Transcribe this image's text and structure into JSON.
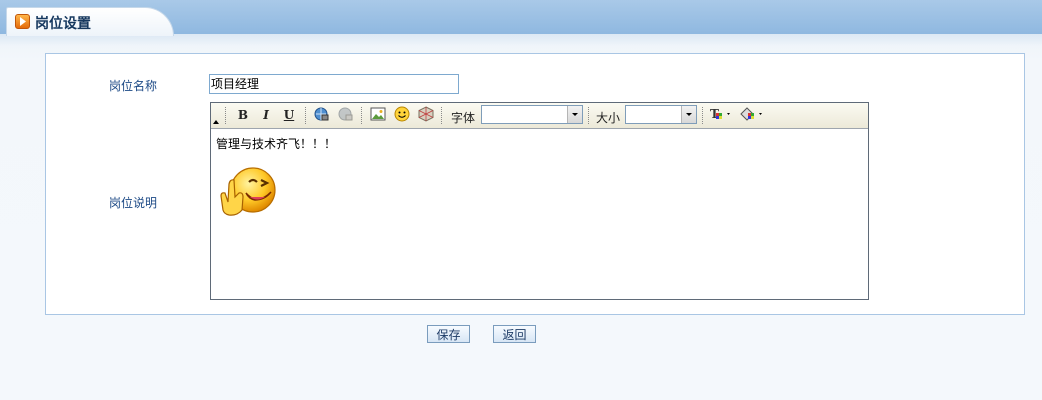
{
  "header": {
    "title": "岗位设置"
  },
  "form": {
    "name_label": "岗位名称",
    "name_value": "项目经理",
    "desc_label": "岗位说明"
  },
  "toolbar": {
    "font_label": "字体",
    "font_value": "",
    "size_label": "大小",
    "size_value": "",
    "buttons": [
      "bold",
      "italic",
      "underline",
      "link",
      "unlink",
      "image",
      "emoticon",
      "media",
      "text-color",
      "background-color"
    ]
  },
  "editor": {
    "content_text": "管理与技术齐飞！！！",
    "emoticon": "victory-smiley"
  },
  "actions": {
    "save_label": "保存",
    "back_label": "返回"
  },
  "colors": {
    "header_bar": "#8fb8e0",
    "label_text": "#1d4a86",
    "panel_border": "#a9c6e4"
  }
}
